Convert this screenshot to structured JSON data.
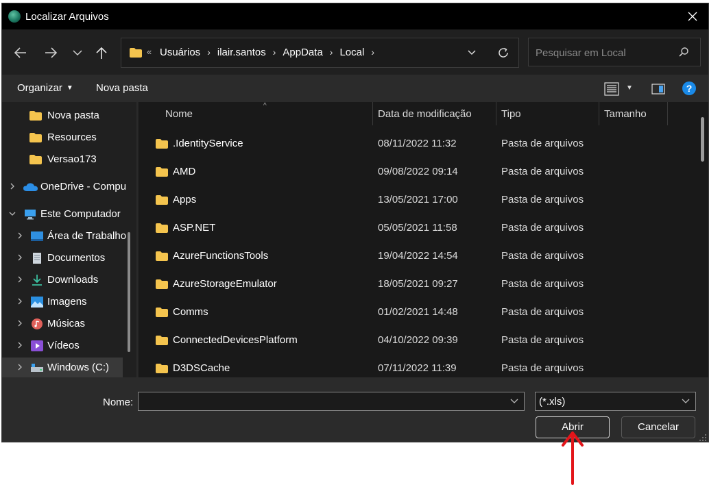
{
  "window": {
    "title": "Localizar Arquivos"
  },
  "address": {
    "breadcrumbs": [
      "Usuários",
      "ilair.santos",
      "AppData",
      "Local"
    ]
  },
  "search": {
    "placeholder": "Pesquisar em Local"
  },
  "toolbar": {
    "organize_label": "Organizar",
    "new_folder_label": "Nova pasta"
  },
  "nav_pane": {
    "items": [
      {
        "label": "Nova pasta",
        "icon": "folder-icon"
      },
      {
        "label": "Resources",
        "icon": "folder-icon"
      },
      {
        "label": "Versao173",
        "icon": "folder-icon"
      },
      {
        "label": "OneDrive - Compu",
        "icon": "onedrive-icon"
      },
      {
        "label": "Este Computador",
        "icon": "computer-icon"
      },
      {
        "label": "Área de Trabalho",
        "icon": "desktop-icon"
      },
      {
        "label": "Documentos",
        "icon": "documents-icon"
      },
      {
        "label": "Downloads",
        "icon": "downloads-icon"
      },
      {
        "label": "Imagens",
        "icon": "pictures-icon"
      },
      {
        "label": "Músicas",
        "icon": "music-icon"
      },
      {
        "label": "Vídeos",
        "icon": "videos-icon"
      },
      {
        "label": "Windows (C:)",
        "icon": "drive-icon"
      }
    ]
  },
  "file_list": {
    "columns": [
      "Nome",
      "Data de modificação",
      "Tipo",
      "Tamanho"
    ],
    "rows": [
      {
        "name": ".IdentityService",
        "modified": "08/11/2022 11:32",
        "type": "Pasta de arquivos"
      },
      {
        "name": "AMD",
        "modified": "09/08/2022 09:14",
        "type": "Pasta de arquivos"
      },
      {
        "name": "Apps",
        "modified": "13/05/2021 17:00",
        "type": "Pasta de arquivos"
      },
      {
        "name": "ASP.NET",
        "modified": "05/05/2021 11:58",
        "type": "Pasta de arquivos"
      },
      {
        "name": "AzureFunctionsTools",
        "modified": "19/04/2022 14:54",
        "type": "Pasta de arquivos"
      },
      {
        "name": "AzureStorageEmulator",
        "modified": "18/05/2021 09:27",
        "type": "Pasta de arquivos"
      },
      {
        "name": "Comms",
        "modified": "01/02/2021 14:48",
        "type": "Pasta de arquivos"
      },
      {
        "name": "ConnectedDevicesPlatform",
        "modified": "04/10/2022 09:39",
        "type": "Pasta de arquivos"
      },
      {
        "name": "D3DSCache",
        "modified": "07/11/2022 11:39",
        "type": "Pasta de arquivos"
      }
    ]
  },
  "bottom": {
    "name_label": "Nome:",
    "name_value": "",
    "file_type_filter": "(*.xls)",
    "open_label": "Abrir",
    "cancel_label": "Cancelar"
  },
  "colors": {
    "accent": "#1a8ae8",
    "folder": "#f4c44e",
    "annotation_arrow": "#e3151a"
  }
}
